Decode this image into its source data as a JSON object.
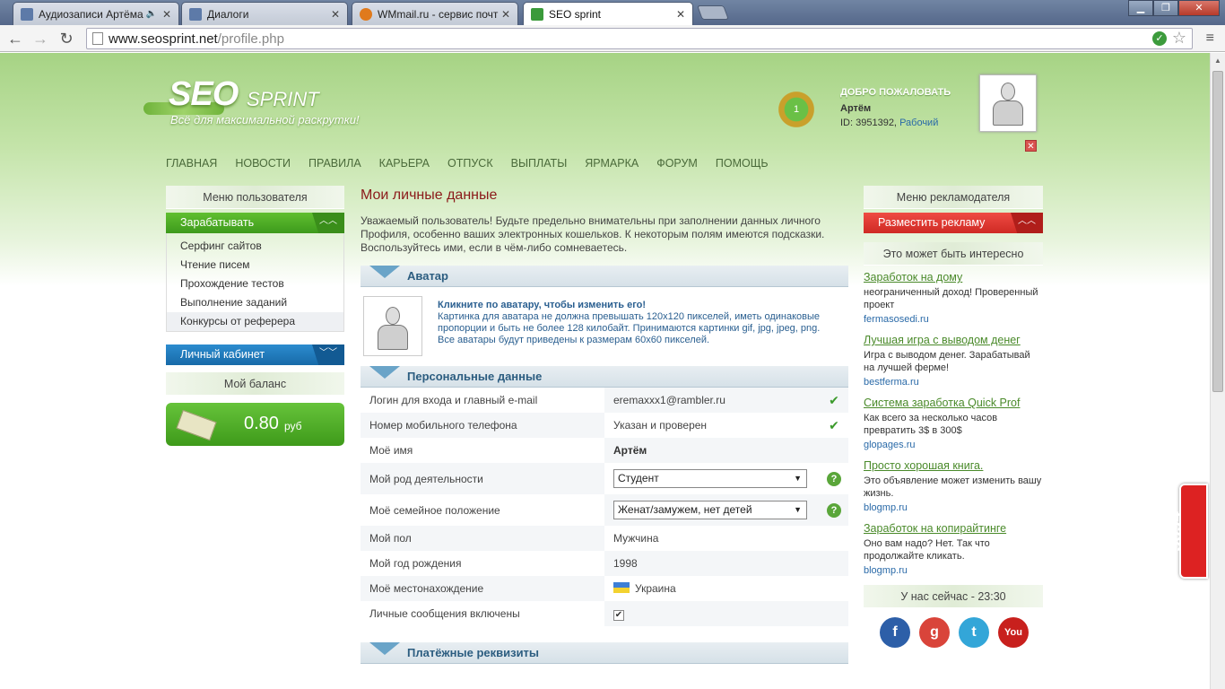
{
  "browser": {
    "tabs": [
      {
        "label": "Аудиозаписи Артёма",
        "color": "#5d7aa8"
      },
      {
        "label": "Диалоги",
        "color": "#5d7aa8"
      },
      {
        "label": "WMmail.ru - сервис почт",
        "color": "#e07a1c"
      },
      {
        "label": "SEO sprint",
        "color": "#3a9a3a"
      }
    ],
    "url_domain": "www.seosprint.net",
    "url_path": "/profile.php"
  },
  "header": {
    "logo_seo": "SEO",
    "logo_sprint": "SPRINT",
    "tagline": "Всё для максимальной раскрутки!",
    "medal_level": "1",
    "welcome": "ДОБРО ПОЖАЛОВАТЬ",
    "user_name": "Артём",
    "user_id": "ID: 3951392,",
    "user_status": "Рабочий"
  },
  "nav": [
    "ГЛАВНАЯ",
    "НОВОСТИ",
    "ПРАВИЛА",
    "КАРЬЕРА",
    "ОТПУСК",
    "ВЫПЛАТЫ",
    "ЯРМАРКА",
    "ФОРУМ",
    "ПОМОЩЬ"
  ],
  "left": {
    "menu_title": "Меню пользователя",
    "earn_label": "Зарабатывать",
    "earn_items": [
      "Серфинг сайтов",
      "Чтение писем",
      "Прохождение тестов",
      "Выполнение заданий",
      "Конкурсы от реферера"
    ],
    "cabinet_label": "Личный кабинет",
    "balance_title": "Мой баланс",
    "balance_amount": "0.80",
    "balance_currency": "руб"
  },
  "main": {
    "title": "Мои личные данные",
    "intro": "Уважаемый пользователь! Будьте предельно внимательны при заполнении данных личного Профиля, особенно ваших электронных кошельков. К некоторым полям имеются подсказки. Воспользуйтесь ими, если в чём-либо сомневаетесь.",
    "avatar_section": "Аватар",
    "avatar_hint_title": "Кликните по аватару, чтобы изменить его!",
    "avatar_hint_text": "Картинка для аватара не должна превышать 120х120 пикселей, иметь одинаковые пропорции и быть не более 128 килобайт. Принимаются картинки gif, jpg, jpeg, png. Все аватары будут приведены к размерам 60х60 пикселей.",
    "personal_section": "Персональные данные",
    "rows": {
      "login_label": "Логин для входа и главный e-mail",
      "login_value": "eremaxxx1@rambler.ru",
      "phone_label": "Номер мобильного телефона",
      "phone_value": "Указан и проверен",
      "name_label": "Моё имя",
      "name_value": "Артём",
      "occupation_label": "Мой род деятельности",
      "occupation_value": "Студент",
      "family_label": "Моё семейное положение",
      "family_value": "Женат/замужем, нет детей",
      "gender_label": "Мой пол",
      "gender_value": "Мужчина",
      "birthyear_label": "Мой год рождения",
      "birthyear_value": "1998",
      "location_label": "Моё местонахождение",
      "location_value": "Украина",
      "messages_label": "Личные сообщения включены",
      "messages_checked": "✔"
    },
    "payment_section": "Платёжные реквизиты"
  },
  "right": {
    "menu_title": "Меню рекламодателя",
    "place_ad": "Разместить рекламу",
    "interest_title": "Это может быть интересно",
    "ads": [
      {
        "title": "Заработок на дому",
        "desc": "неограниченный доход! Проверенный проект",
        "site": "fermasosedi.ru"
      },
      {
        "title": "Лучшая игра с выводом денег",
        "desc": "Игра с выводом денег. Зарабатывай на лучшей ферме!",
        "site": "bestferma.ru"
      },
      {
        "title": "Система заработка Quick Prof",
        "desc": "Как всего за несколько часов превратить 3$ в 300$",
        "site": "glopages.ru"
      },
      {
        "title": "Просто хорошая книга.",
        "desc": "Это объявление может изменить вашу жизнь.",
        "site": "blogmp.ru"
      },
      {
        "title": "Заработок на копирайтинге",
        "desc": "Оно вам надо? Нет. Так что продолжайте кликать.",
        "site": "blogmp.ru"
      }
    ],
    "now_label": "У нас сейчас - 23:30",
    "social": [
      {
        "icon": "facebook-icon",
        "glyph": "f",
        "color": "#2d5fa8"
      },
      {
        "icon": "google-icon",
        "glyph": "g",
        "color": "#d9443a"
      },
      {
        "icon": "twitter-icon",
        "glyph": "t",
        "color": "#33a6d8"
      },
      {
        "icon": "youtube-icon",
        "glyph": "You",
        "color": "#c8201d"
      }
    ]
  },
  "side_widget": "5694"
}
